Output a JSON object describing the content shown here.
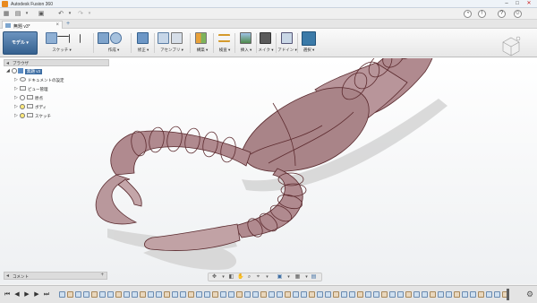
{
  "window": {
    "title": "Autodesk Fusion 360"
  },
  "document_tab": {
    "label": "無題 v3*"
  },
  "workspace": {
    "label": "モデル ▾"
  },
  "toolbar_groups": [
    {
      "label": "スケッチ ▾"
    },
    {
      "label": "作成 ▾"
    },
    {
      "label": "修正 ▾"
    },
    {
      "label": "アセンブリ ▾"
    },
    {
      "label": "構築 ▾"
    },
    {
      "label": "検査 ▾"
    },
    {
      "label": "挿入 ▾"
    },
    {
      "label": "メイク ▾"
    },
    {
      "label": "アドイン ▾"
    },
    {
      "label": "選択 ▾"
    }
  ],
  "browser": {
    "title": "ブラウザ",
    "root": "無題 v3",
    "items": [
      {
        "label": "ドキュメントの設定"
      },
      {
        "label": "ビュー管理"
      },
      {
        "label": "原点"
      },
      {
        "label": "ボディ"
      },
      {
        "label": "スケッチ"
      }
    ]
  },
  "comments_panel": {
    "title": "コメント"
  },
  "colors": {
    "body_fill": "#b08a8f",
    "body_stroke": "#5a2a2e",
    "workspace_accent": "#3e6ea3",
    "select_accent": "#3b7aa8"
  }
}
